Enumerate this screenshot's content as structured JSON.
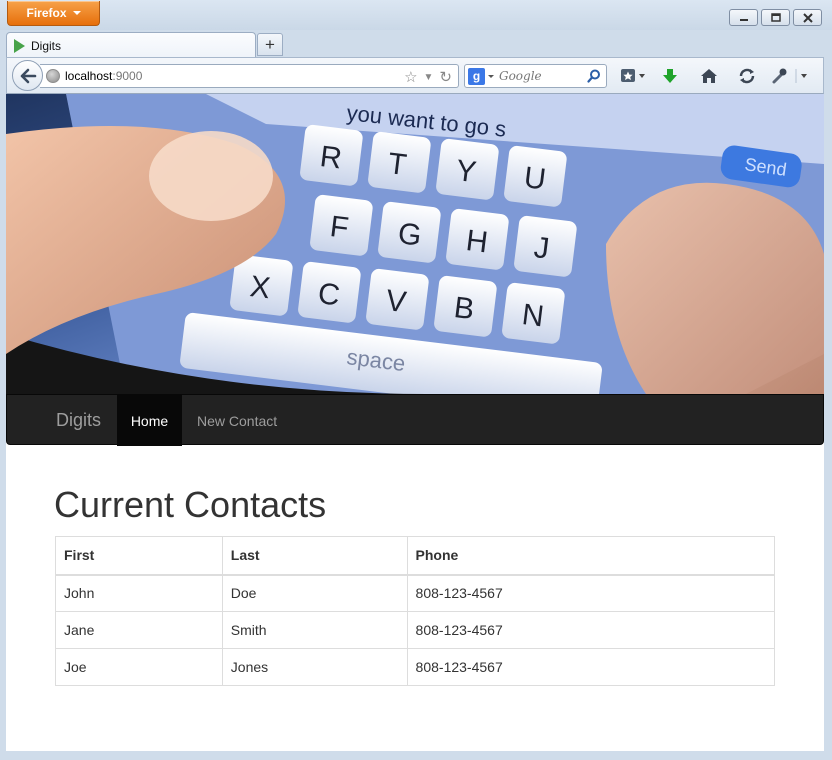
{
  "browser": {
    "app_button": "Firefox",
    "tab_title": "Digits",
    "url_host": "localhost",
    "url_port": ":9000",
    "search_placeholder": "Google",
    "search_engine_logo": "g"
  },
  "site": {
    "brand": "Digits",
    "nav": [
      "Home",
      "New Contact"
    ],
    "active_nav": "Home",
    "hero_text": "you want to go s",
    "hero_keys": [
      "R",
      "T",
      "Y",
      "U",
      "F",
      "G",
      "H",
      "J",
      "X",
      "C",
      "V",
      "B",
      "N"
    ],
    "hero_space": "space",
    "hero_send": "Send"
  },
  "contacts": {
    "title": "Current Contacts",
    "columns": [
      "First",
      "Last",
      "Phone"
    ],
    "rows": [
      [
        "John",
        "Doe",
        "808-123-4567"
      ],
      [
        "Jane",
        "Smith",
        "808-123-4567"
      ],
      [
        "Joe",
        "Jones",
        "808-123-4567"
      ]
    ]
  },
  "colors": {
    "navbar_bg": "#222222",
    "nav_active_bg": "#080808",
    "firefox_orange": "#e66f0b"
  }
}
